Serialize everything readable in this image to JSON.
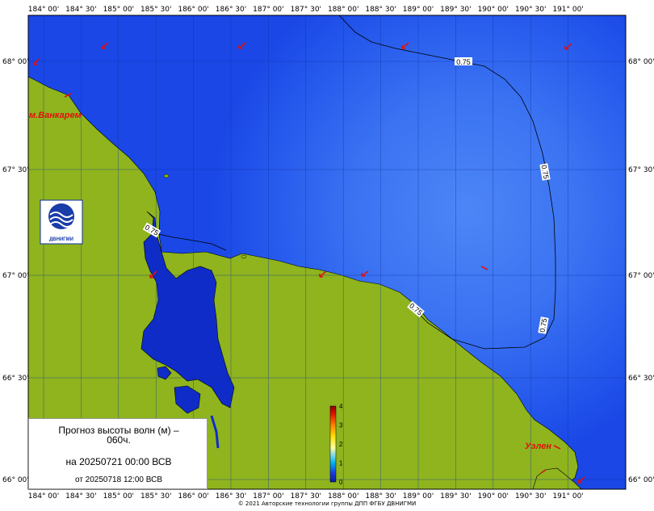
{
  "map": {
    "lon_labels": [
      "184° 00'",
      "184° 30'",
      "185° 00'",
      "185° 30'",
      "186° 00'",
      "186° 30'",
      "187° 00'",
      "187° 30'",
      "188° 00'",
      "188° 30'",
      "189° 00'",
      "189° 30'",
      "190° 00'",
      "190° 30'",
      "191° 00'"
    ],
    "lat_labels": [
      "68° 00'",
      "67° 30'",
      "67° 00'",
      "66° 30'",
      "66° 00'"
    ],
    "places": [
      {
        "name": "м.Ванкарем"
      },
      {
        "name": "Уэлен"
      }
    ],
    "contour_label": "0.75",
    "colors": {
      "sea_deep": "#1a47e6",
      "sea_mid": "#2b60f0",
      "sea_light": "#4d86f6",
      "land": "#8fb41e",
      "lagoon": "#0f2cc8",
      "arrow": "#e01010"
    }
  },
  "colorbar": {
    "ticks": [
      "4",
      "3",
      "2",
      "1",
      "0"
    ],
    "range": [
      0,
      4
    ]
  },
  "caption": {
    "line1": "Прогноз высоты волн (м) –",
    "line1b": "060ч.",
    "line2": "на 20250721 00:00 ВСВ",
    "line3": "от 20250718 12:00 ВСВ"
  },
  "logo": {
    "text": "ДВНИГМИ"
  },
  "footer": {
    "copyright": "© 2021 Авторские технологии группы ДПП ФГБУ ДВНИГМИ"
  }
}
